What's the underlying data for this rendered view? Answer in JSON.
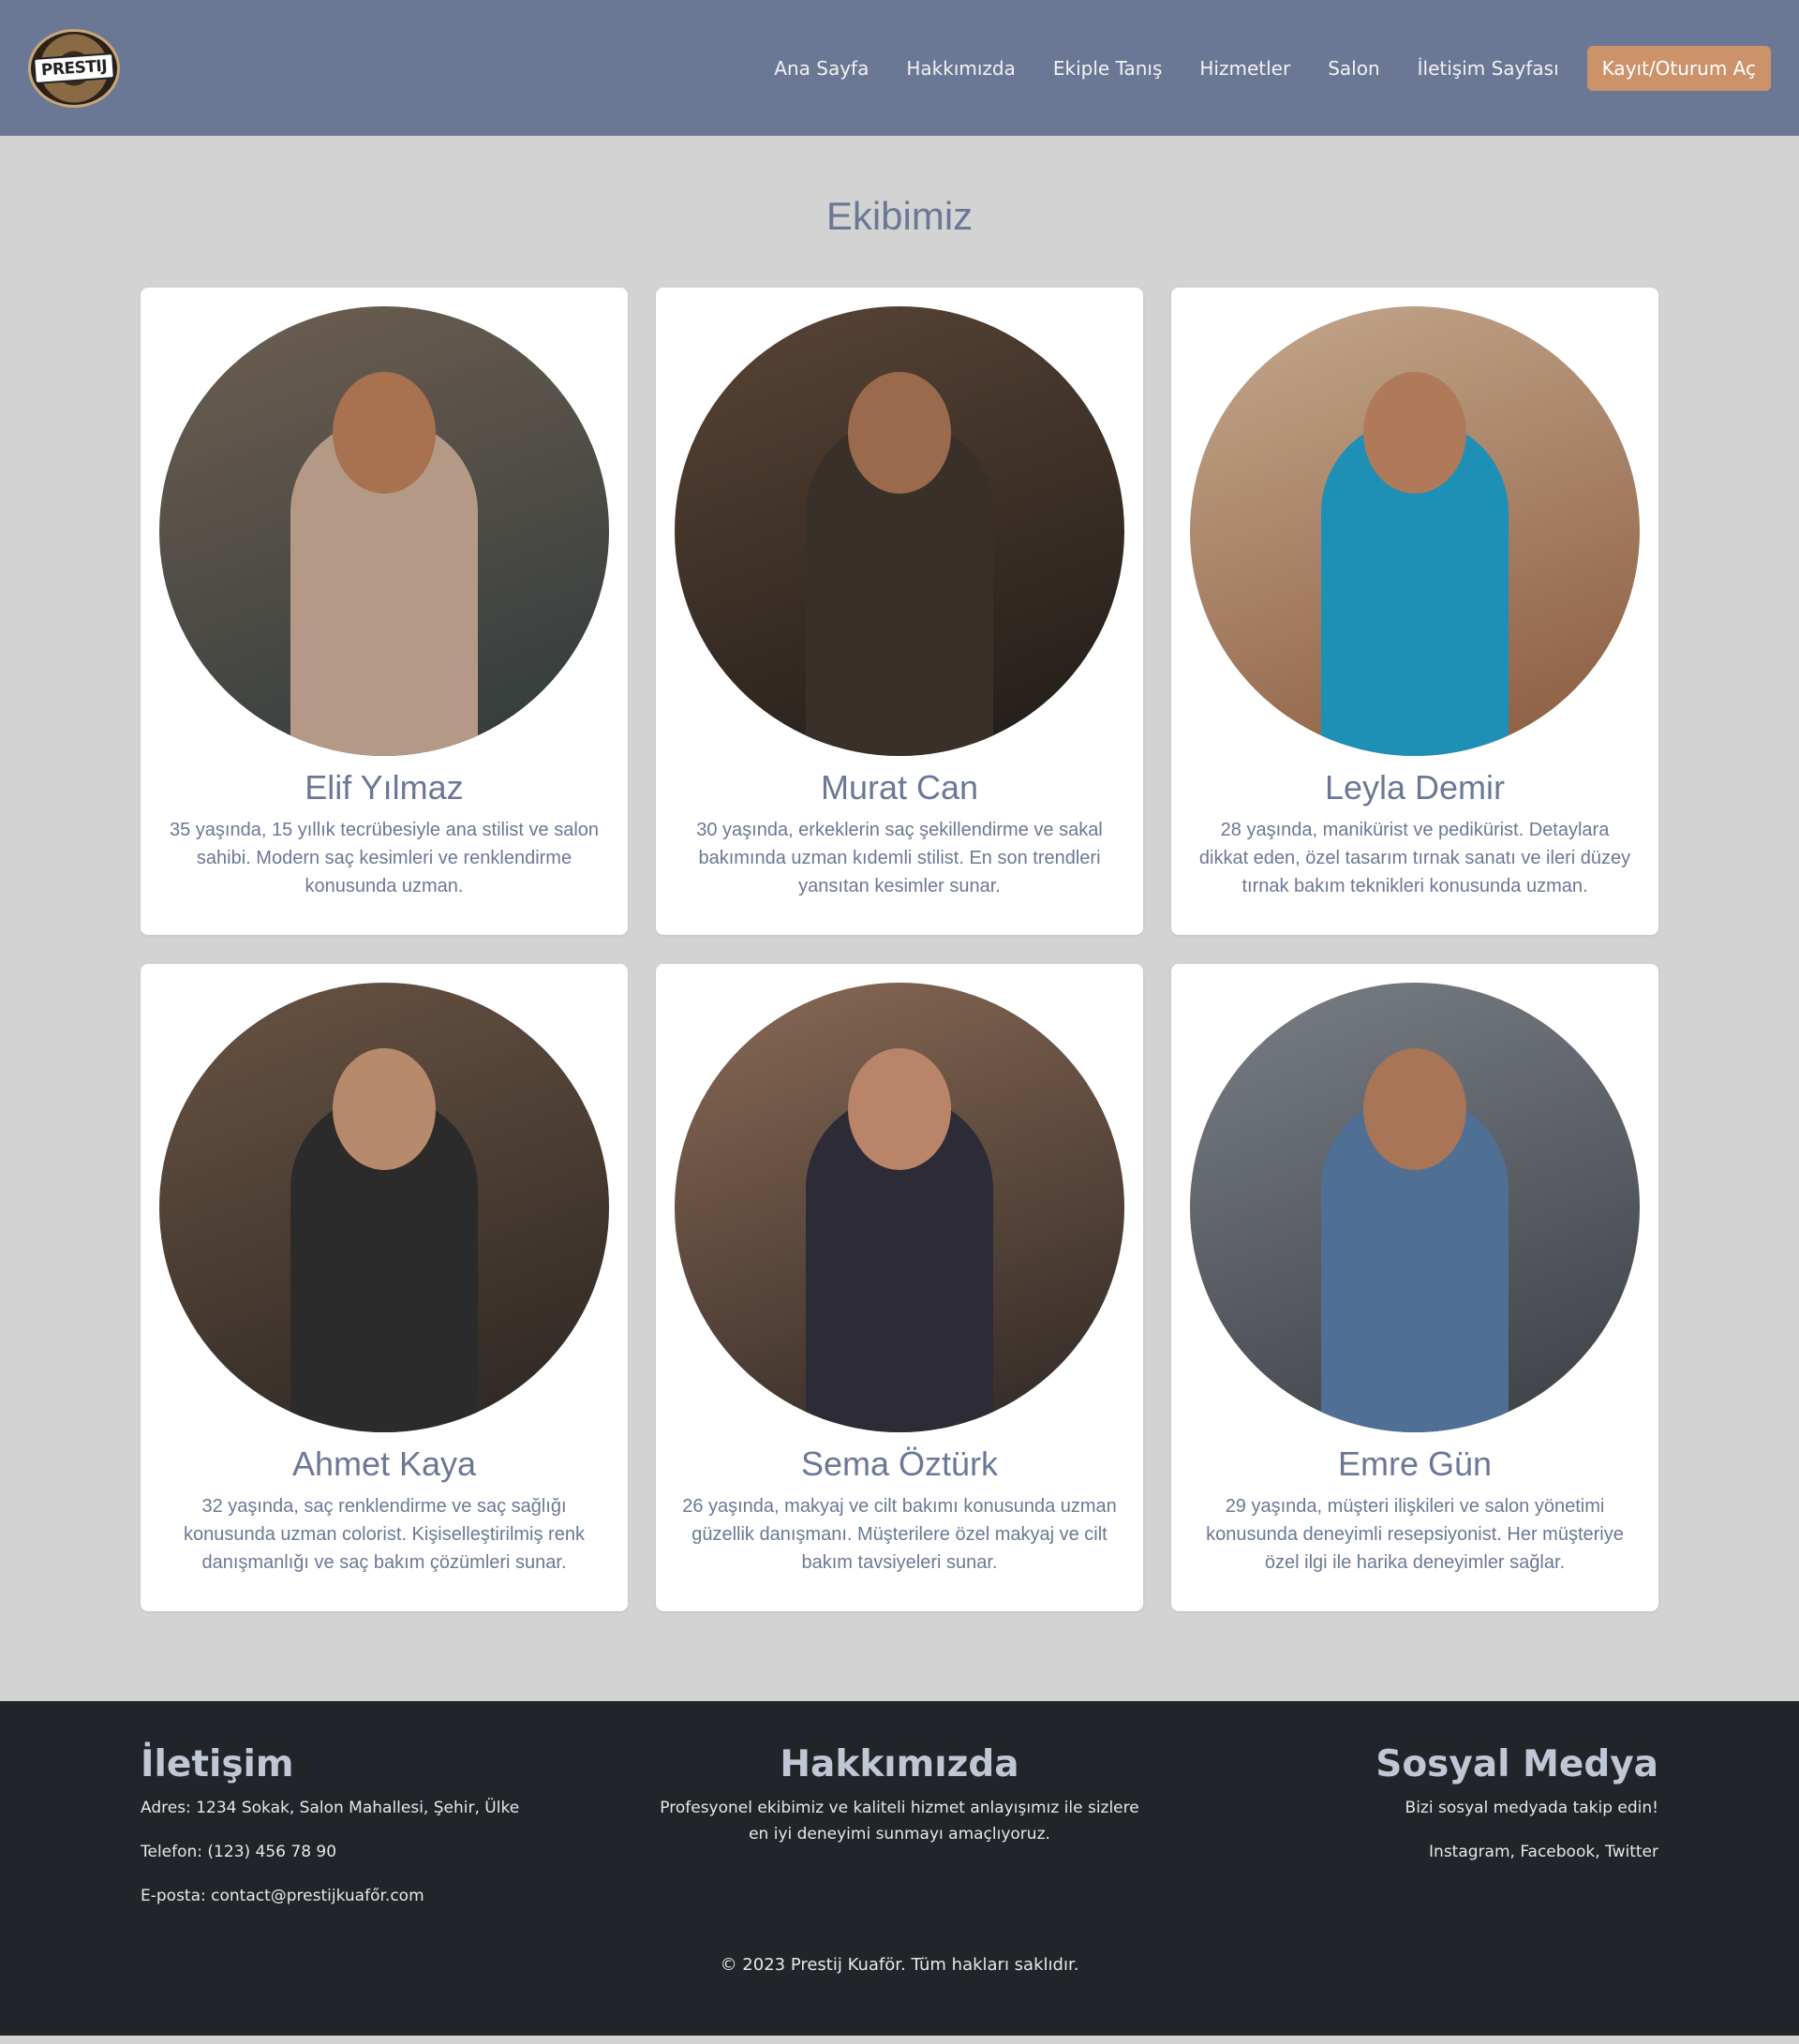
{
  "brand": {
    "logo_text": "PRESTIJ"
  },
  "nav": {
    "links": [
      "Ana Sayfa",
      "Hakkımızda",
      "Ekiple Tanış",
      "Hizmetler",
      "Salon",
      "İletişim Sayfası"
    ],
    "cta": "Kayıt/Oturum Aç"
  },
  "main": {
    "title": "Ekibimiz",
    "team": [
      {
        "name": "Elif Yılmaz",
        "bio": "35 yaşında, 15 yıllık tecrübesiyle ana stilist ve salon sahibi. Modern saç kesimleri ve renklendirme konusunda uzman.",
        "colors": {
          "bg": "#6f5f52",
          "bg2": "#2f3a3b",
          "figure": "#b49a86",
          "head": "#a8714f"
        }
      },
      {
        "name": "Murat Can",
        "bio": "30 yaşında, erkeklerin saç şekillendirme ve sakal bakımında uzman kıdemli stilist. En son trendleri yansıtan kesimler sunar.",
        "colors": {
          "bg": "#5a4536",
          "bg2": "#1f1b18",
          "figure": "#3a302a",
          "head": "#9b6a4d"
        }
      },
      {
        "name": "Leyla Demir",
        "bio": "28 yaşında, manikürist ve pedikürist. Detaylara dikkat eden, özel tasarım tırnak sanatı ve ileri düzey tırnak bakım teknikleri konusunda uzman.",
        "colors": {
          "bg": "#c4a88c",
          "bg2": "#8a5a3f",
          "figure": "#1e8fb5",
          "head": "#b07a5a"
        }
      },
      {
        "name": "Ahmet Kaya",
        "bio": "32 yaşında, saç renklendirme ve saç sağlığı konusunda uzman colorist. Kişiselleştirilmiş renk danışmanlığı ve saç bakım çözümleri sunar.",
        "colors": {
          "bg": "#6a5443",
          "bg2": "#2a2522",
          "figure": "#2b2b2b",
          "head": "#b88a6c"
        }
      },
      {
        "name": "Sema Öztürk",
        "bio": "26 yaşında, makyaj ve cilt bakımı konusunda uzman güzellik danışmanı. Müşterilere özel makyaj ve cilt bakım tavsiyeleri sunar.",
        "colors": {
          "bg": "#8a6a55",
          "bg2": "#2e2724",
          "figure": "#2d2c36",
          "head": "#b98468"
        }
      },
      {
        "name": "Emre Gün",
        "bio": "29 yaşında, müşteri ilişkileri ve salon yönetimi konusunda deneyimli resepsiyonist. Her müşteriye özel ilgi ile harika deneyimler sağlar.",
        "colors": {
          "bg": "#7a7f86",
          "bg2": "#3b3f44",
          "figure": "#4f6f95",
          "head": "#a87556"
        }
      }
    ]
  },
  "footer": {
    "contact": {
      "title": "İletişim",
      "address": "Adres: 1234 Sokak, Salon Mahallesi, Şehir, Ülke",
      "phone": "Telefon: (123) 456 78 90",
      "email": "E-posta: contact@prestijkuafőr.com"
    },
    "about": {
      "title": "Hakkımızda",
      "text": "Profesyonel ekibimiz ve kaliteli hizmet anlayışımız ile sizlere en iyi deneyimi sunmayı amaçlıyoruz."
    },
    "social": {
      "title": "Sosyal Medya",
      "text": "Bizi sosyal medyada takip edin!",
      "links": "Instagram, Facebook, Twitter"
    },
    "copyright": "© 2023 Prestij Kuaför. Tüm hakları saklıdır."
  }
}
